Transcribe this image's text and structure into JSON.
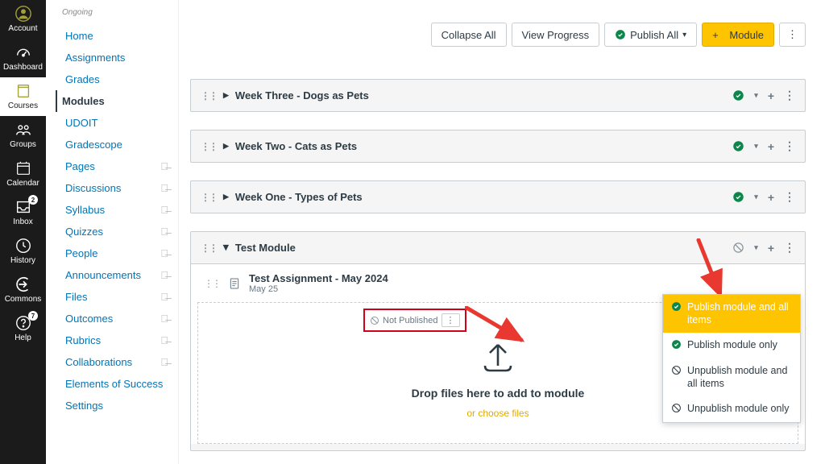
{
  "global_nav": {
    "items": [
      {
        "label": "Account"
      },
      {
        "label": "Dashboard"
      },
      {
        "label": "Courses"
      },
      {
        "label": "Groups"
      },
      {
        "label": "Calendar"
      },
      {
        "label": "Inbox",
        "badge": "2"
      },
      {
        "label": "History"
      },
      {
        "label": "Commons"
      },
      {
        "label": "Help",
        "badge": "7"
      }
    ]
  },
  "course_nav": {
    "section": "Ongoing",
    "items": [
      {
        "label": "Home"
      },
      {
        "label": "Assignments"
      },
      {
        "label": "Grades"
      },
      {
        "label": "Modules"
      },
      {
        "label": "UDOIT"
      },
      {
        "label": "Gradescope"
      },
      {
        "label": "Pages"
      },
      {
        "label": "Discussions"
      },
      {
        "label": "Syllabus"
      },
      {
        "label": "Quizzes"
      },
      {
        "label": "People"
      },
      {
        "label": "Announcements"
      },
      {
        "label": "Files"
      },
      {
        "label": "Outcomes"
      },
      {
        "label": "Rubrics"
      },
      {
        "label": "Collaborations"
      },
      {
        "label": "Elements of Success"
      },
      {
        "label": "Settings"
      }
    ]
  },
  "toolbar": {
    "collapse": "Collapse All",
    "progress": "View Progress",
    "publish_all": "Publish All",
    "add_module": "Module"
  },
  "modules": [
    {
      "title": "Week Three - Dogs as Pets"
    },
    {
      "title": "Week Two - Cats as Pets"
    },
    {
      "title": "Week One - Types of Pets"
    }
  ],
  "test_module": {
    "title": "Test Module",
    "item_title": "Test Assignment - May 2024",
    "item_due": "May 25",
    "not_published": "Not Published",
    "drop_text": "Drop files here to add to module",
    "choose": "or choose files"
  },
  "publish_menu": {
    "opt1": "Publish module and all items",
    "opt2": "Publish module only",
    "opt3": "Unpublish module and all items",
    "opt4": "Unpublish module only"
  }
}
